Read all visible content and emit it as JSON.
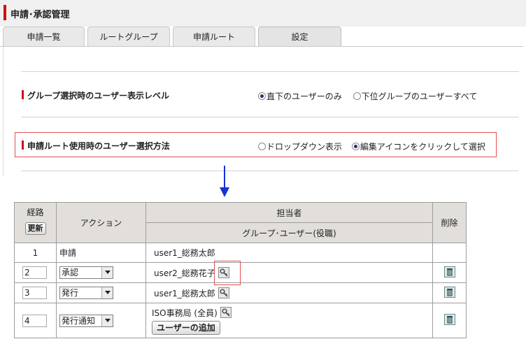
{
  "app": {
    "title": "申請･承認管理"
  },
  "tabs": [
    "申請一覧",
    "ルートグループ",
    "申請ルート",
    "設定"
  ],
  "settings": {
    "display_level": {
      "label": "グループ選択時のユーザー表示レベル",
      "options": [
        "直下のユーザーのみ",
        "下位グループのユーザーすべて"
      ],
      "selected": 0
    },
    "selection_method": {
      "label": "申請ルート使用時のユーザー選択方法",
      "options": [
        "ドロップダウン表示",
        "編集アイコンをクリックして選択"
      ],
      "selected": 1
    }
  },
  "route_table": {
    "headers": {
      "route": "経路",
      "update_button": "更新",
      "action": "アクション",
      "assignee": "担当者",
      "assignee_sub": "グループ･ユーザー(役職)",
      "delete": "削除"
    },
    "rows": [
      {
        "num": "1",
        "action": "申請",
        "assignee": "user1_総務太郎"
      },
      {
        "num": "2",
        "action": "承認",
        "assignee": "user2_総務花子"
      },
      {
        "num": "3",
        "action": "発行",
        "assignee": "user1_総務太郎"
      },
      {
        "num": "4",
        "action": "発行通知",
        "assignee": "ISO事務局 (全員)",
        "add_user_button": "ユーザーの追加"
      }
    ]
  },
  "colors": {
    "accent_red": "#cc1111",
    "arrow_blue": "#1533d8",
    "highlight_red": "#e05050"
  }
}
